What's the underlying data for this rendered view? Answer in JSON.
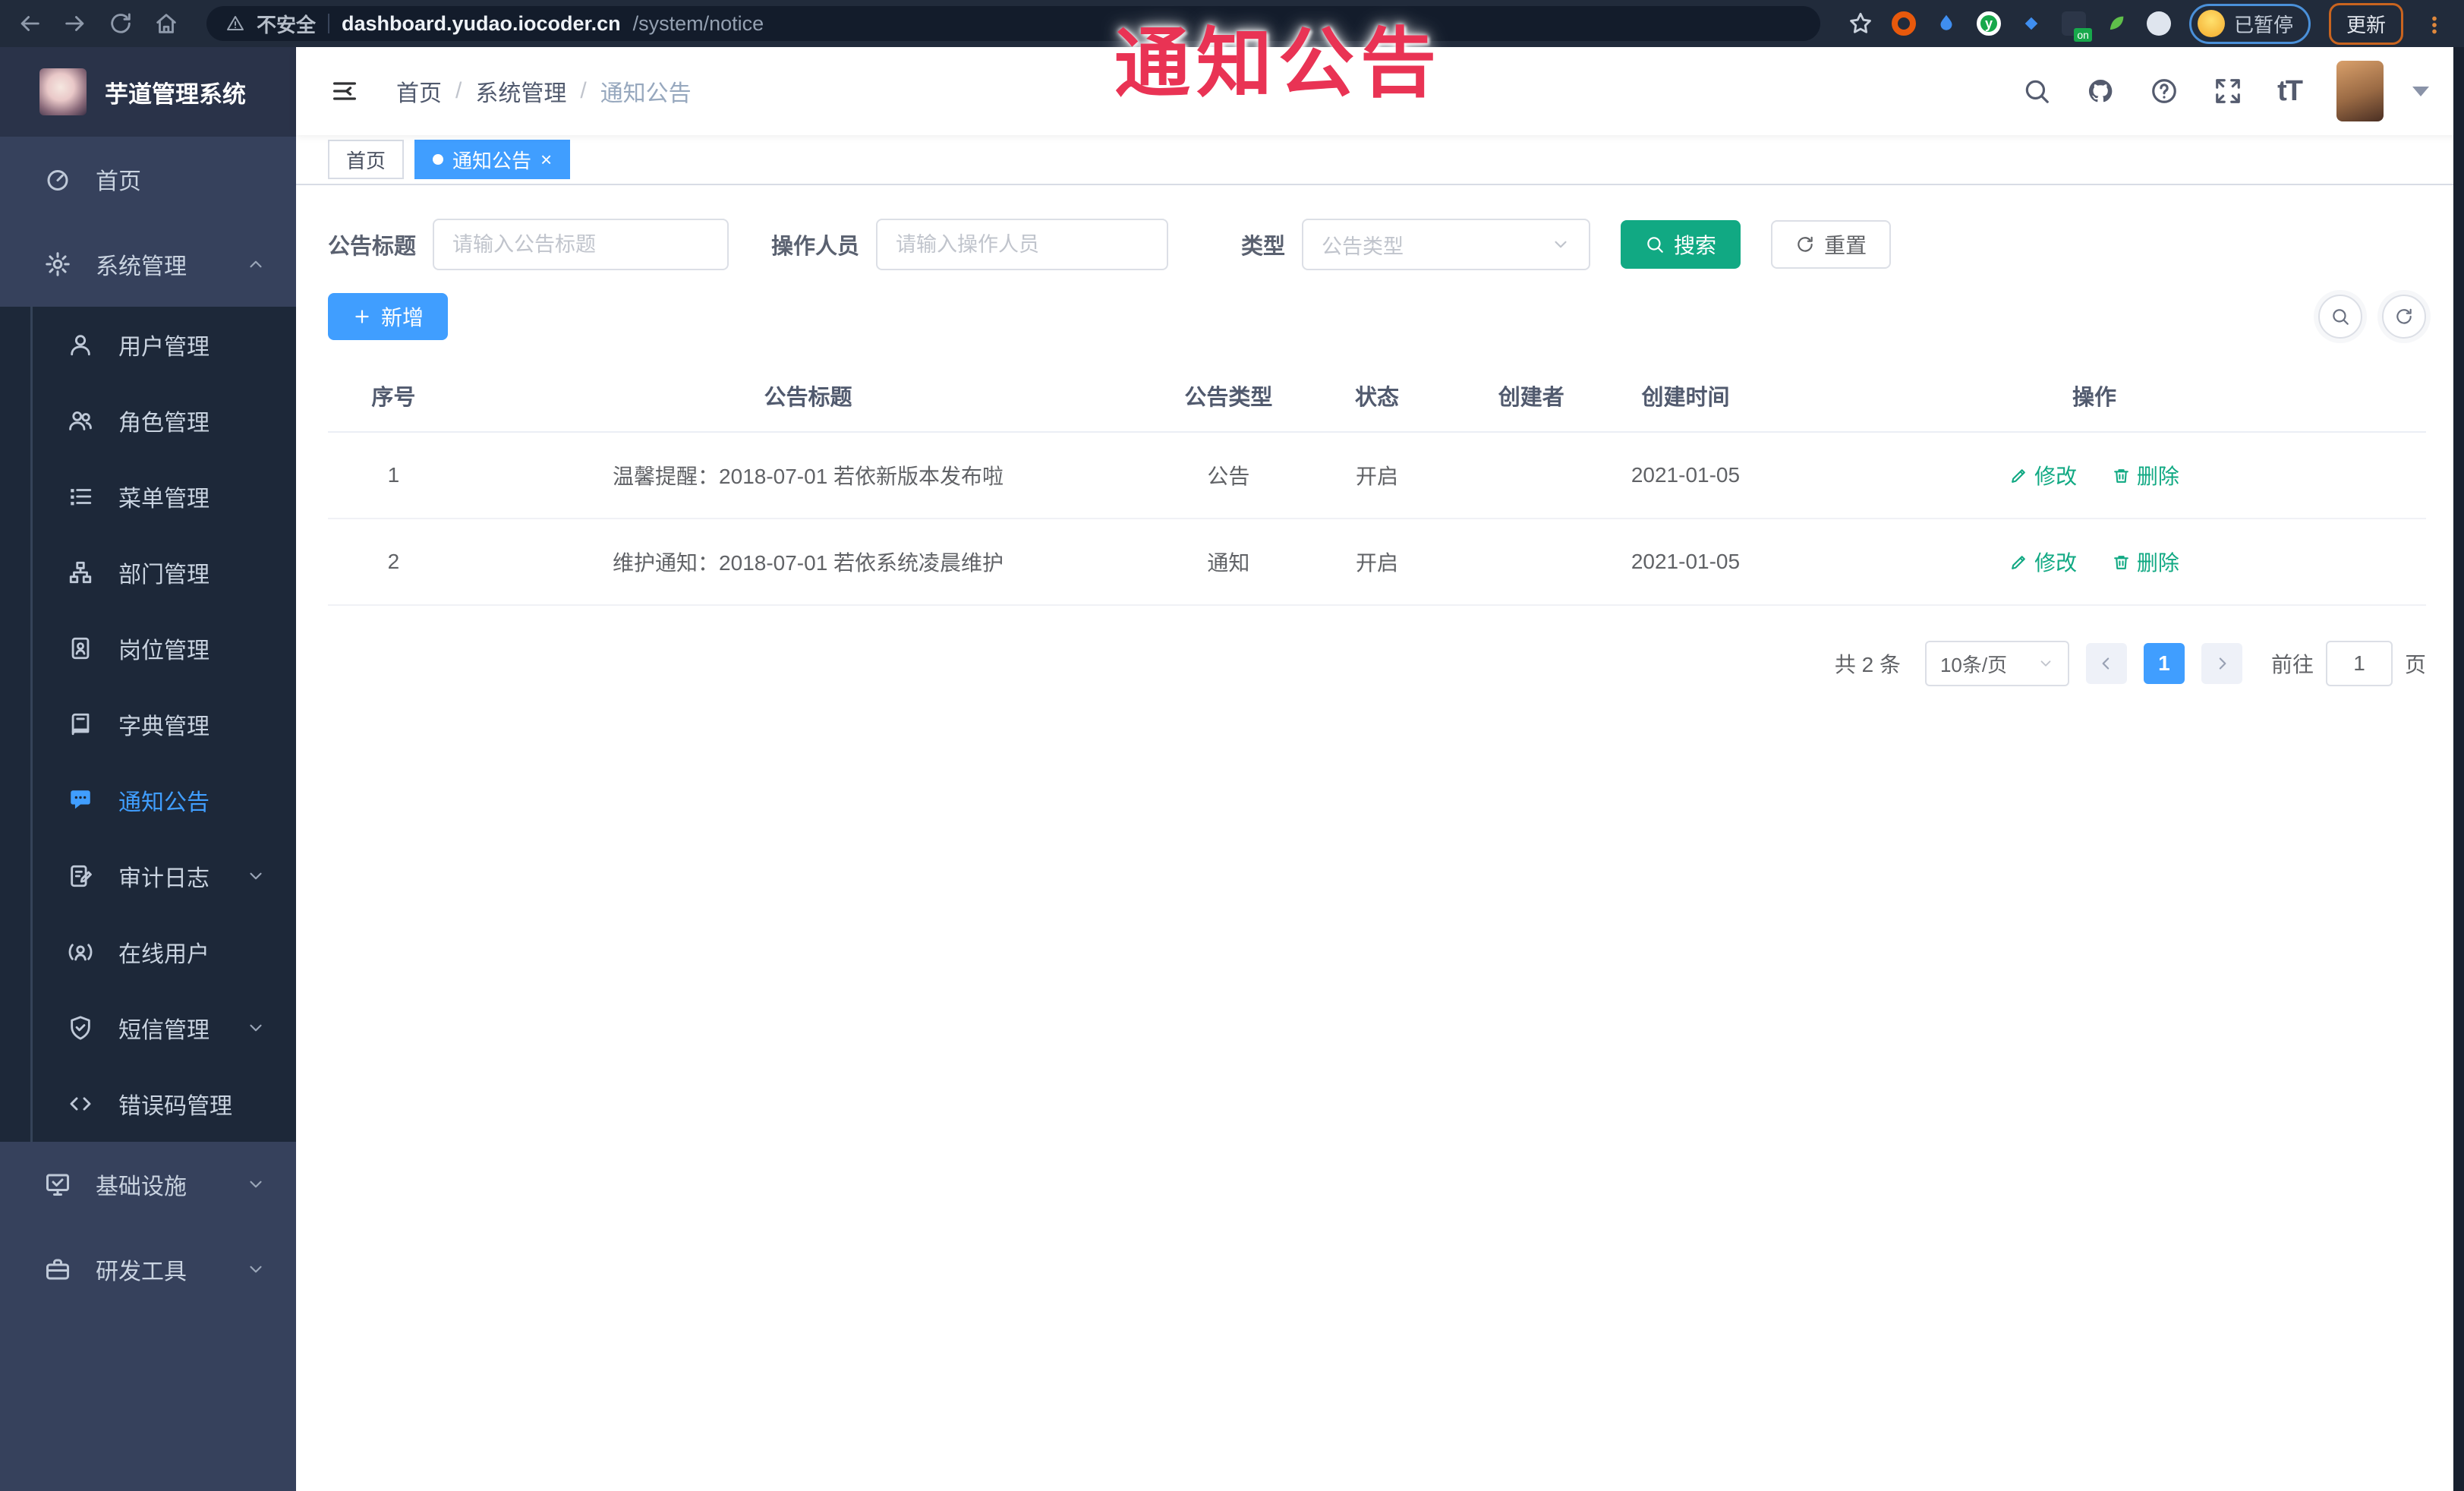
{
  "browser": {
    "security_label": "不安全",
    "url_host": "dashboard.yudao.iocoder.cn",
    "url_path": "/system/notice",
    "extension_badge": "on",
    "extension_letter": "y",
    "profile_status": "已暂停",
    "update_label": "更新"
  },
  "annotation": {
    "text": "通知公告"
  },
  "sidebar": {
    "title": "芋道管理系统",
    "menu": {
      "home": "首页",
      "system": "系统管理",
      "infrastructure": "基础设施",
      "devtools": "研发工具"
    },
    "system_children": [
      {
        "label": "用户管理",
        "icon": "user-icon"
      },
      {
        "label": "角色管理",
        "icon": "users-icon"
      },
      {
        "label": "菜单管理",
        "icon": "menu-list-icon"
      },
      {
        "label": "部门管理",
        "icon": "org-tree-icon"
      },
      {
        "label": "岗位管理",
        "icon": "id-badge-icon"
      },
      {
        "label": "字典管理",
        "icon": "dictionary-icon"
      },
      {
        "label": "通知公告",
        "icon": "announcement-icon"
      },
      {
        "label": "审计日志",
        "icon": "audit-log-icon"
      },
      {
        "label": "在线用户",
        "icon": "online-users-icon"
      },
      {
        "label": "短信管理",
        "icon": "shield-icon"
      },
      {
        "label": "错误码管理",
        "icon": "code-icon"
      }
    ]
  },
  "topbar": {
    "breadcrumb": [
      "首页",
      "系统管理",
      "通知公告"
    ],
    "separator": "/",
    "font_size_label": "tT"
  },
  "tags": {
    "home": "首页",
    "active": "通知公告",
    "close": "×"
  },
  "filter": {
    "title_label": "公告标题",
    "title_placeholder": "请输入公告标题",
    "operator_label": "操作人员",
    "operator_placeholder": "请输入操作人员",
    "type_label": "类型",
    "type_placeholder": "公告类型",
    "search_label": "搜索",
    "reset_label": "重置"
  },
  "toolbar": {
    "add_label": "新增"
  },
  "table": {
    "columns": [
      "序号",
      "公告标题",
      "公告类型",
      "状态",
      "创建者",
      "创建时间",
      "操作"
    ],
    "rows": [
      {
        "no": "1",
        "title": "温馨提醒：2018-07-01 若依新版本发布啦",
        "type": "公告",
        "status": "开启",
        "creator": "",
        "created_at": "2021-01-05"
      },
      {
        "no": "2",
        "title": "维护通知：2018-07-01 若依系统凌晨维护",
        "type": "通知",
        "status": "开启",
        "creator": "",
        "created_at": "2021-01-05"
      }
    ],
    "actions": {
      "edit": "修改",
      "delete": "删除"
    }
  },
  "pagination": {
    "total": "共 2 条",
    "page_size": "10条/页",
    "current_page": "1",
    "goto_label": "前往",
    "goto_value": "1",
    "unit_label": "页"
  },
  "colors": {
    "accent_blue": "#409EFF",
    "theme_teal": "#11A983",
    "annotation_red": "#E93354",
    "sidebar_bg": "#36415C",
    "submenu_bg": "#1D2839",
    "chrome_bg": "#212B3B"
  }
}
